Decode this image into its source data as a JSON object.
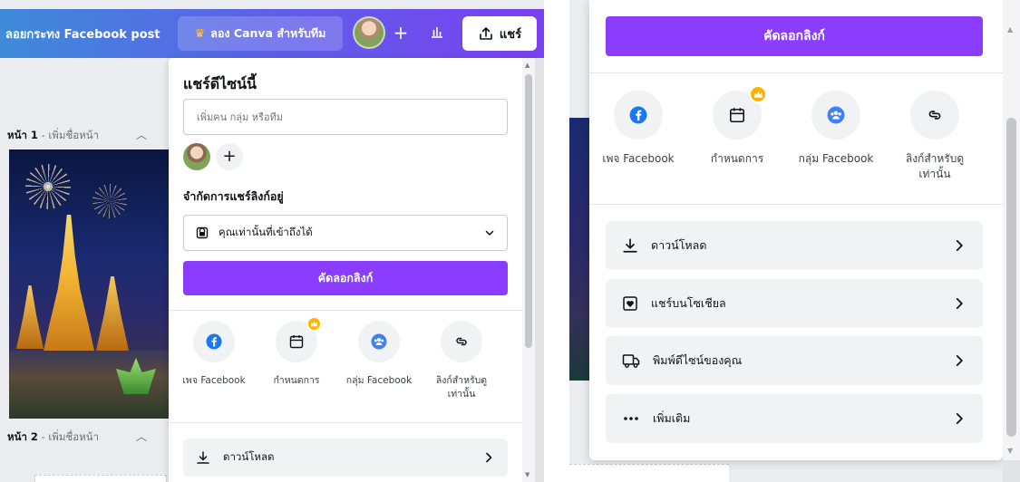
{
  "editor": {
    "doc_title": "ลอยกระทง Facebook post",
    "try_canva_label": "ลอง Canva สำหรับทีม",
    "share_label": "แชร์",
    "plus": "+"
  },
  "pages": {
    "page1_label": "หน้า 1",
    "page1_add": " - เพิ่มชื่อหน้า",
    "page2_label": "หน้า 2",
    "page2_add": " - เพิ่มชื่อหน้า"
  },
  "share_panel": {
    "title": "แชร์ดีไซน์นี้",
    "invite_placeholder": "เพิ่มคน กลุ่ม หรือทีม",
    "plus": "+",
    "link_section_title": "จำกัดการแชร์ลิงก์อยู่",
    "access_value": "คุณเท่านั้นที่เข้าถึงได้",
    "copy_link_label": "คัดลอกลิงก์",
    "options": [
      {
        "label": "เพจ Facebook",
        "icon": "facebook-icon"
      },
      {
        "label": "กำหนดการ",
        "icon": "calendar-icon",
        "premium": true
      },
      {
        "label": "กลุ่ม Facebook",
        "icon": "group-icon"
      },
      {
        "label": "ลิงก์สำหรับดู",
        "label2": "เท่านั้น",
        "icon": "link-icon"
      }
    ],
    "download_label": "ดาวน์โหลด"
  },
  "right_panel": {
    "copy_link_label": "คัดลอกลิงก์",
    "options": [
      {
        "label": "เพจ Facebook"
      },
      {
        "label": "กำหนดการ"
      },
      {
        "label": "กลุ่ม Facebook"
      },
      {
        "label": "ลิงก์สำหรับดู",
        "label2": "เท่านั้น"
      }
    ],
    "rows": [
      {
        "label": "ดาวน์โหลด",
        "icon": "download-icon"
      },
      {
        "label": "แชร์บนโซเชียล",
        "icon": "heart-social-icon"
      },
      {
        "label": "พิมพ์ดีไซน์ของคุณ",
        "icon": "truck-icon"
      },
      {
        "label": "เพิ่มเติม",
        "icon": "more-dots-icon"
      }
    ]
  },
  "colors": {
    "accent": "#8b3dff",
    "facebook": "#1877f2",
    "group": "#3f80f7",
    "crown": "#ffb400"
  }
}
